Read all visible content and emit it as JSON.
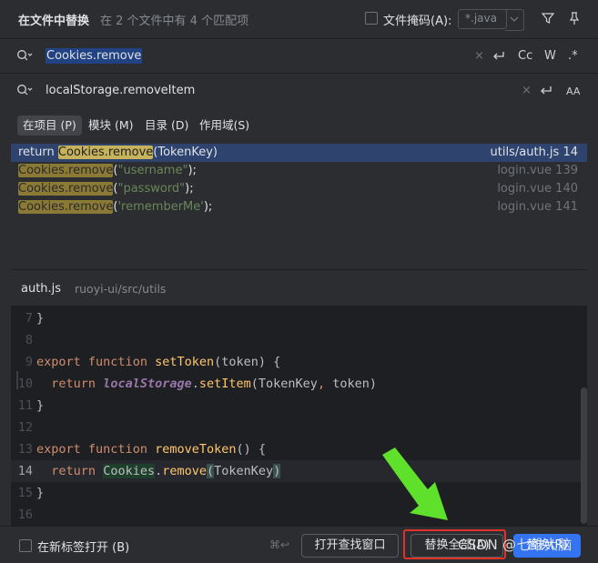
{
  "header": {
    "title": "在文件中替换",
    "match_summary": "在 2 个文件中有 4 个匹配项",
    "file_mask_label": "文件掩码(A):",
    "file_mask_value": "*.java",
    "file_mask_checked": false
  },
  "search": {
    "find_text": "Cookies.remove",
    "replace_text": "localStorage.removeItem",
    "find_options": [
      "Cc",
      "W",
      ".*"
    ],
    "replace_options": [
      "AA"
    ]
  },
  "scope_tabs": [
    {
      "label": "在项目 (P)",
      "active": true
    },
    {
      "label": "模块 (M)",
      "active": false
    },
    {
      "label": "目录 (D)",
      "active": false
    },
    {
      "label": "作用域(S)",
      "active": false
    }
  ],
  "results": [
    {
      "prefix": "return ",
      "match": "Cookies.remove",
      "suffix": "(TokenKey)",
      "arg": "",
      "file": "utils/auth.js 14",
      "selected": true
    },
    {
      "prefix": "",
      "match": "Cookies.remove",
      "suffix": "(",
      "arg": "\"username\"",
      "close": ");",
      "file": "login.vue 139",
      "selected": false
    },
    {
      "prefix": "",
      "match": "Cookies.remove",
      "suffix": "(",
      "arg": "\"password\"",
      "close": ");",
      "file": "login.vue 140",
      "selected": false
    },
    {
      "prefix": "",
      "match": "Cookies.remove",
      "suffix": "(",
      "arg": "'rememberMe'",
      "close": ");",
      "file": "login.vue 141",
      "selected": false
    }
  ],
  "preview": {
    "file_name": "auth.js",
    "file_path": "ruoyi-ui/src/utils",
    "lines": [
      {
        "n": "7",
        "text": "}"
      },
      {
        "n": "8",
        "text": ""
      },
      {
        "n": "9",
        "text": "export function setToken(token) {"
      },
      {
        "n": "10",
        "text": "  return localStorage.setItem(TokenKey, token)"
      },
      {
        "n": "11",
        "text": "}"
      },
      {
        "n": "12",
        "text": ""
      },
      {
        "n": "13",
        "text": "export function removeToken() {"
      },
      {
        "n": "14",
        "text": "  return Cookies.remove(TokenKey)"
      },
      {
        "n": "15",
        "text": "}"
      },
      {
        "n": "16",
        "text": ""
      }
    ],
    "current_line": "14"
  },
  "footer": {
    "open_in_new_tab_label": "在新标签打开 (B)",
    "shortcut": "⌘↩",
    "open_find_window_label": "打开查找窗口",
    "replace_all_label": "替换全部(A)",
    "replace_label": "替换(R)"
  },
  "watermark": "CSDN @七维大脑",
  "colors": {
    "background": "#2b2d30",
    "editor_background": "#1e1f22",
    "selection": "#2e436e",
    "match_highlight": "#8a7a35",
    "primary_button": "#3574f0",
    "annotation_red": "#e0312b",
    "arrow_green": "#5fe02a"
  }
}
